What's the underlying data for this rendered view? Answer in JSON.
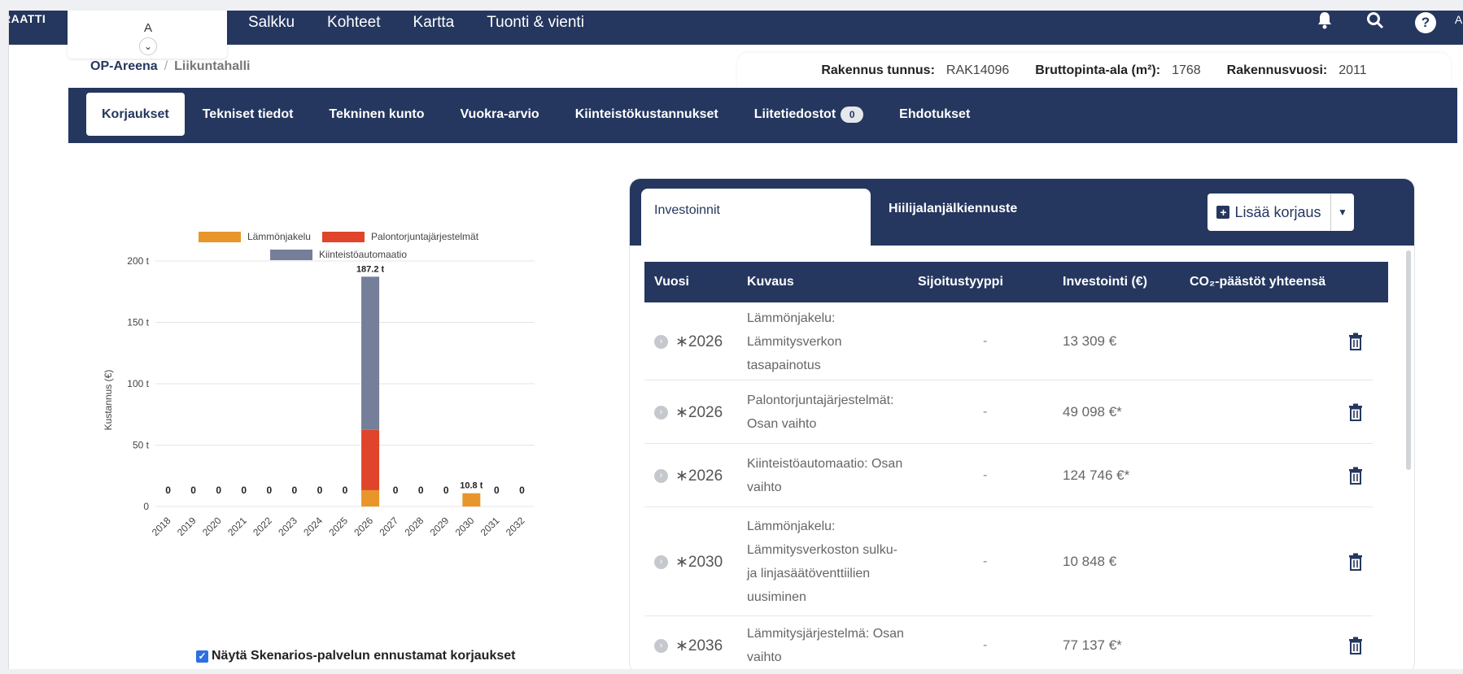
{
  "topnav": {
    "brand_fragment": "RAATTI",
    "org_letter": "A",
    "items": [
      "Salkku",
      "Kohteet",
      "Kartta",
      "Tuonti & vienti"
    ],
    "user_fragment": "Au"
  },
  "breadcrumb": {
    "parent": "OP-Areena",
    "separator": "/",
    "current": "Liikuntahalli"
  },
  "building_info": {
    "id_label": "Rakennus tunnus:",
    "id_value": "RAK14096",
    "area_label": "Bruttopinta-ala (m²):",
    "area_value": "1768",
    "year_label": "Rakennusvuosi:",
    "year_value": "2011"
  },
  "tabs": {
    "items": [
      "Korjaukset",
      "Tekniset tiedot",
      "Tekninen kunto",
      "Vuokra-arvio",
      "Kiinteistökustannukset",
      "Liitetiedostot",
      "Ehdotukset"
    ],
    "attachments_count": "0",
    "active": "Korjaukset"
  },
  "chart_data": {
    "type": "bar",
    "stacked": true,
    "categories": [
      "2018",
      "2019",
      "2020",
      "2021",
      "2022",
      "2023",
      "2024",
      "2025",
      "2026",
      "2027",
      "2028",
      "2029",
      "2030",
      "2031",
      "2032"
    ],
    "series": [
      {
        "name": "Lämmönjakelu",
        "color": "#e8962b",
        "values": [
          0,
          0,
          0,
          0,
          0,
          0,
          0,
          0,
          13.3,
          0,
          0,
          0,
          10.8,
          0,
          0
        ]
      },
      {
        "name": "Palontorjuntajärjestelmät",
        "color": "#e0452b",
        "values": [
          0,
          0,
          0,
          0,
          0,
          0,
          0,
          0,
          49.1,
          0,
          0,
          0,
          0,
          0,
          0
        ]
      },
      {
        "name": "Kiinteistöautomaatio",
        "color": "#757f99",
        "values": [
          0,
          0,
          0,
          0,
          0,
          0,
          0,
          0,
          124.8,
          0,
          0,
          0,
          0,
          0,
          0
        ]
      }
    ],
    "totals_labels": [
      "0",
      "0",
      "0",
      "0",
      "0",
      "0",
      "0",
      "0",
      "187.2 t",
      "0",
      "0",
      "0",
      "10.8 t",
      "0",
      "0"
    ],
    "ylabel": "Kustannus (€)",
    "yticks": [
      "0",
      "50 t",
      "100 t",
      "150 t",
      "200 t"
    ],
    "ylim": [
      0,
      200
    ],
    "legend_position": "top"
  },
  "checkbox": {
    "label": "Näytä Skenarios-palvelun ennustamat korjaukset",
    "checked": true
  },
  "panel": {
    "tab_active": "Investoinnit",
    "tab_other": "Hiilijalanjälkiennuste",
    "add_button": "Lisää korjaus",
    "columns": [
      "Vuosi",
      "Kuvaus",
      "Sijoitustyyppi",
      "Investointi (€)",
      "CO₂-päästöt yhteensä"
    ],
    "rows": [
      {
        "year": "∗2026",
        "desc": [
          "Lämmönjakelu:",
          "Lämmitysverkon",
          "tasapainotus"
        ],
        "type": "-",
        "investment": "13 309 €"
      },
      {
        "year": "∗2026",
        "desc": [
          "Palontorjuntajärjestelmät:",
          "Osan vaihto"
        ],
        "type": "-",
        "investment": "49 098 €*"
      },
      {
        "year": "∗2026",
        "desc": [
          "Kiinteistöautomaatio: Osan",
          "vaihto"
        ],
        "type": "-",
        "investment": "124 746 €*"
      },
      {
        "year": "∗2030",
        "desc": [
          "Lämmönjakelu:",
          "Lämmitysverkoston sulku-",
          "ja linjasäätöventtiilien",
          "uusiminen"
        ],
        "type": "-",
        "investment": "10 848 €"
      },
      {
        "year": "∗2036",
        "desc": [
          "Lämmitysjärjestelmä: Osan",
          "vaihto"
        ],
        "type": "-",
        "investment": "77 137 €*"
      }
    ]
  }
}
